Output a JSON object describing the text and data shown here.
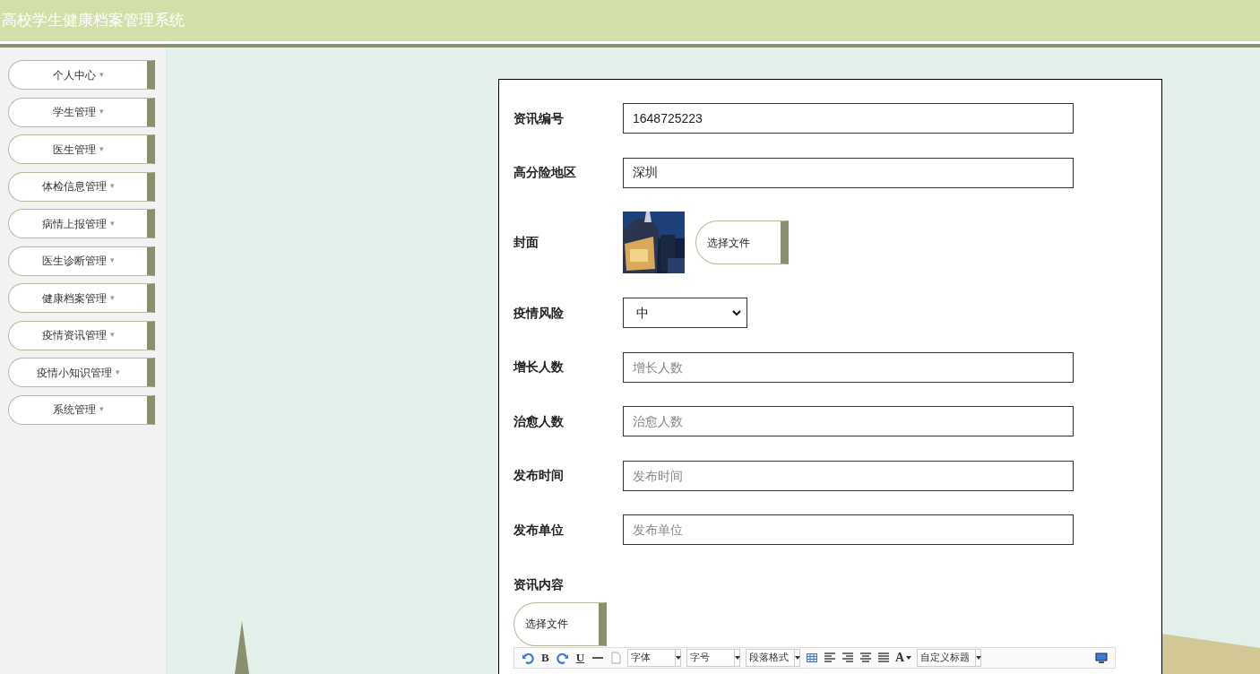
{
  "header": {
    "title": "高校学生健康档案管理系统"
  },
  "sidebar": {
    "items": [
      {
        "label": "个人中心",
        "caret": "▾"
      },
      {
        "label": "学生管理",
        "caret": "▾"
      },
      {
        "label": "医生管理",
        "caret": "▾"
      },
      {
        "label": "体检信息管理",
        "caret": "▾"
      },
      {
        "label": "病情上报管理",
        "caret": "▾"
      },
      {
        "label": "医生诊断管理",
        "caret": "▾"
      },
      {
        "label": "健康档案管理",
        "caret": "▾"
      },
      {
        "label": "疫情资讯管理",
        "caret": "▾"
      },
      {
        "label": "疫情小知识管理",
        "caret": "▾"
      },
      {
        "label": "系统管理",
        "caret": "▾"
      }
    ]
  },
  "form": {
    "fields": [
      {
        "kind": "text",
        "label": "资讯编号",
        "value": "1648725223"
      },
      {
        "kind": "text",
        "label": "高分险地区",
        "value": "深圳"
      },
      {
        "label": "封面",
        "button": "选择文件"
      },
      {
        "kind": "select",
        "label": "疫情风险",
        "value": "中"
      },
      {
        "kind": "text",
        "label": "增长人数",
        "placeholder": "增长人数"
      },
      {
        "kind": "text",
        "label": "治愈人数",
        "placeholder": "治愈人数"
      },
      {
        "kind": "text",
        "label": "发布时间",
        "placeholder": "发布时间"
      },
      {
        "kind": "text",
        "label": "发布单位",
        "placeholder": "发布单位"
      }
    ],
    "content": {
      "label": "资讯内容",
      "button": "选择文件",
      "toolbar": [
        {
          "kind": "undo"
        },
        {
          "kind": "bold",
          "label": "B"
        },
        {
          "kind": "redo"
        },
        {
          "kind": "underline",
          "label": "U"
        },
        {
          "kind": "rule"
        },
        {
          "kind": "page"
        },
        {
          "kind": "dropdown",
          "label": "字体"
        },
        {
          "kind": "dropdown",
          "label": "字号"
        },
        {
          "kind": "dropdown",
          "label": "段落格式"
        },
        {
          "kind": "table"
        },
        {
          "kind": "align-left"
        },
        {
          "kind": "align-right"
        },
        {
          "kind": "align-center"
        },
        {
          "kind": "justify"
        },
        {
          "kind": "color",
          "label": "A"
        },
        {
          "kind": "dropdown",
          "label": "自定义标题"
        },
        {
          "kind": "preview"
        }
      ]
    }
  }
}
